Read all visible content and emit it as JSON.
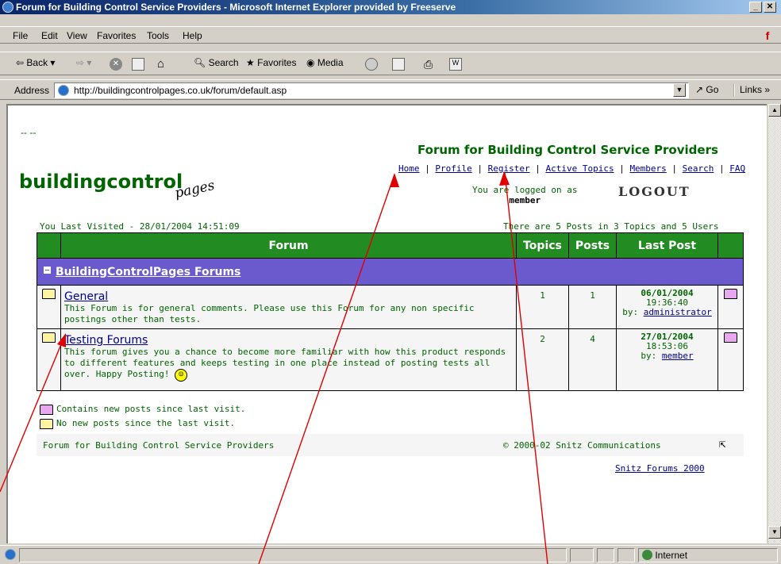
{
  "window": {
    "title": "Forum for Building Control Service Providers - Microsoft Internet Explorer provided by Freeserve"
  },
  "menu": {
    "items": [
      "File",
      "Edit",
      "View",
      "Favorites",
      "Tools",
      "Help"
    ]
  },
  "toolbar": {
    "back": "Back",
    "search": "Search",
    "favorites": "Favorites",
    "media": "Media"
  },
  "address": {
    "label": "Address",
    "url": "http://buildingcontrolpages.co.uk/forum/default.asp",
    "go": "Go",
    "links": "Links"
  },
  "page": {
    "dashes": "-- --",
    "logo_main": "buildingcontrol",
    "logo_sub": "pages",
    "forum_title": "Forum for Building Control Service Providers",
    "nav": [
      "Home",
      "Profile",
      "Register",
      "Active Topics",
      "Members",
      "Search",
      "FAQ"
    ],
    "logged_on_text": "You are logged on as",
    "username": "member",
    "logout": "LOGOUT",
    "last_visited": "You Last Visited - 28/01/2004 14:51:09",
    "stats": "There are 5 Posts in 3 Topics and 5 Users"
  },
  "table": {
    "headers": [
      "Forum",
      "Topics",
      "Posts",
      "Last Post"
    ],
    "category": "BuildingControlPages Forums",
    "forums": [
      {
        "name": "General",
        "description": "This Forum is for general comments. Please use this Forum for any non specific postings other than tests.",
        "topics": "1",
        "posts": "1",
        "last_date": "06/01/2004",
        "last_time": "19:36:40",
        "by": "by:",
        "last_user": "administrator"
      },
      {
        "name": "Testing Forums",
        "description": "This forum gives you a chance to become more familiar with how this product responds to different features and keeps testing in one place instead of posting tests all over. Happy Posting!",
        "topics": "2",
        "posts": "4",
        "last_date": "27/01/2004",
        "last_time": "18:53:06",
        "by": "by:",
        "last_user": "member"
      }
    ]
  },
  "legend": {
    "new": "Contains new posts since last visit.",
    "none": "No new posts since the last visit."
  },
  "footer": {
    "left": "Forum for Building Control Service Providers",
    "right": "© 2000-02 Snitz Communications",
    "snitz": "Snitz Forums 2000"
  },
  "status": {
    "zone": "Internet"
  }
}
